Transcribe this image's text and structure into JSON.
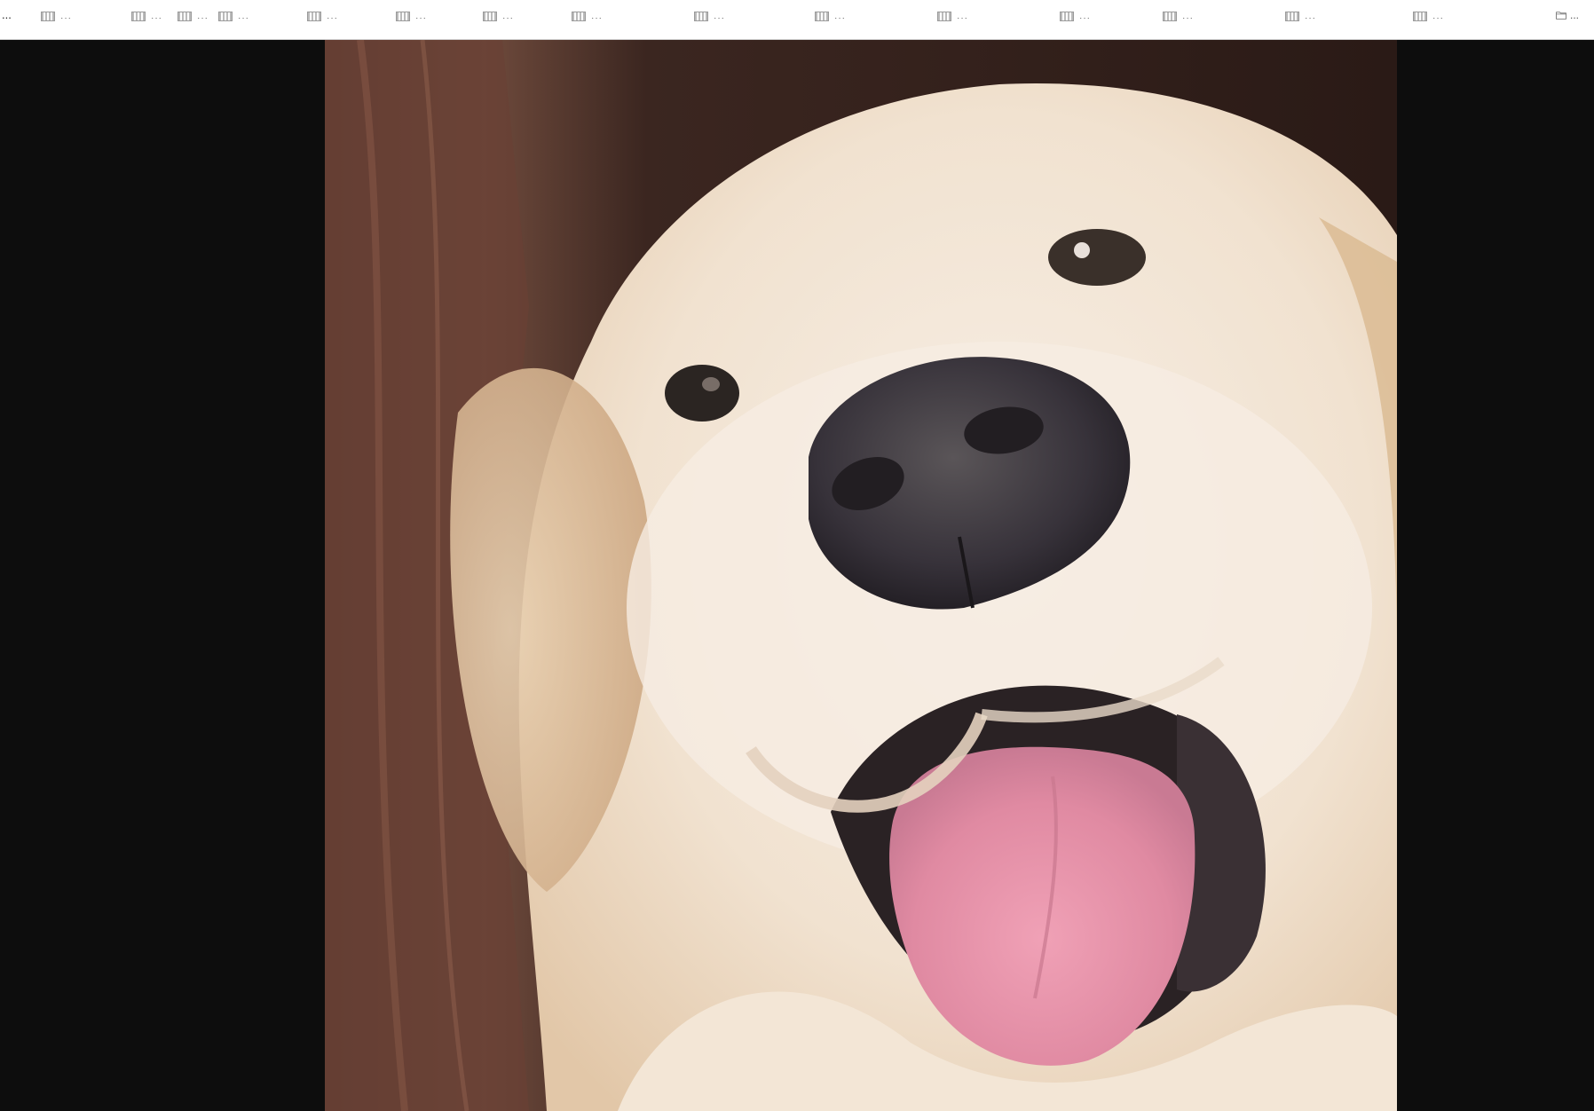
{
  "bookmarks_bar": {
    "overflow_label": "...",
    "items": [
      {
        "label": "..."
      },
      {
        "label": "..."
      },
      {
        "label": "..."
      },
      {
        "label": "..."
      },
      {
        "label": "..."
      },
      {
        "label": "..."
      },
      {
        "label": "..."
      },
      {
        "label": "..."
      },
      {
        "label": "..."
      },
      {
        "label": "..."
      },
      {
        "label": "..."
      },
      {
        "label": "..."
      },
      {
        "label": "..."
      },
      {
        "label": "..."
      },
      {
        "label": "..."
      },
      {
        "label": "..."
      }
    ],
    "folder_label": "..."
  },
  "colors": {
    "bar_background": "#ffffff",
    "viewer_background": "#0d0d0d",
    "fur": "#f2e4d2",
    "nose": "#3a3538",
    "tongue": "#e58ea6",
    "hair_background": "#4a2a22"
  },
  "icons": {
    "bookmark_favicon": "page-favicon-icon",
    "folder": "folder-icon"
  }
}
